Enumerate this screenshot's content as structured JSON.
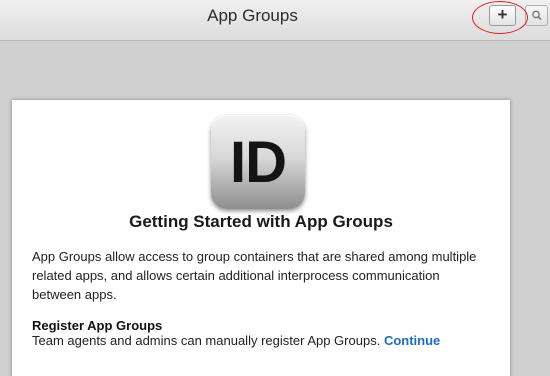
{
  "toolbar": {
    "title": "App Groups",
    "add_icon": "plus-icon",
    "search_icon": "search-icon",
    "highlight_color": "#e02020"
  },
  "content": {
    "app_icon_text": "ID",
    "heading": "Getting Started with App Groups",
    "intro": "App Groups allow access to group containers that are shared among multiple related apps, and allows certain additional interprocess communication between apps.",
    "register_heading": "Register App Groups",
    "register_text": "Team agents and admins can manually register App Groups.",
    "continue_label": "Continue",
    "link_color": "#1a6fbf"
  }
}
